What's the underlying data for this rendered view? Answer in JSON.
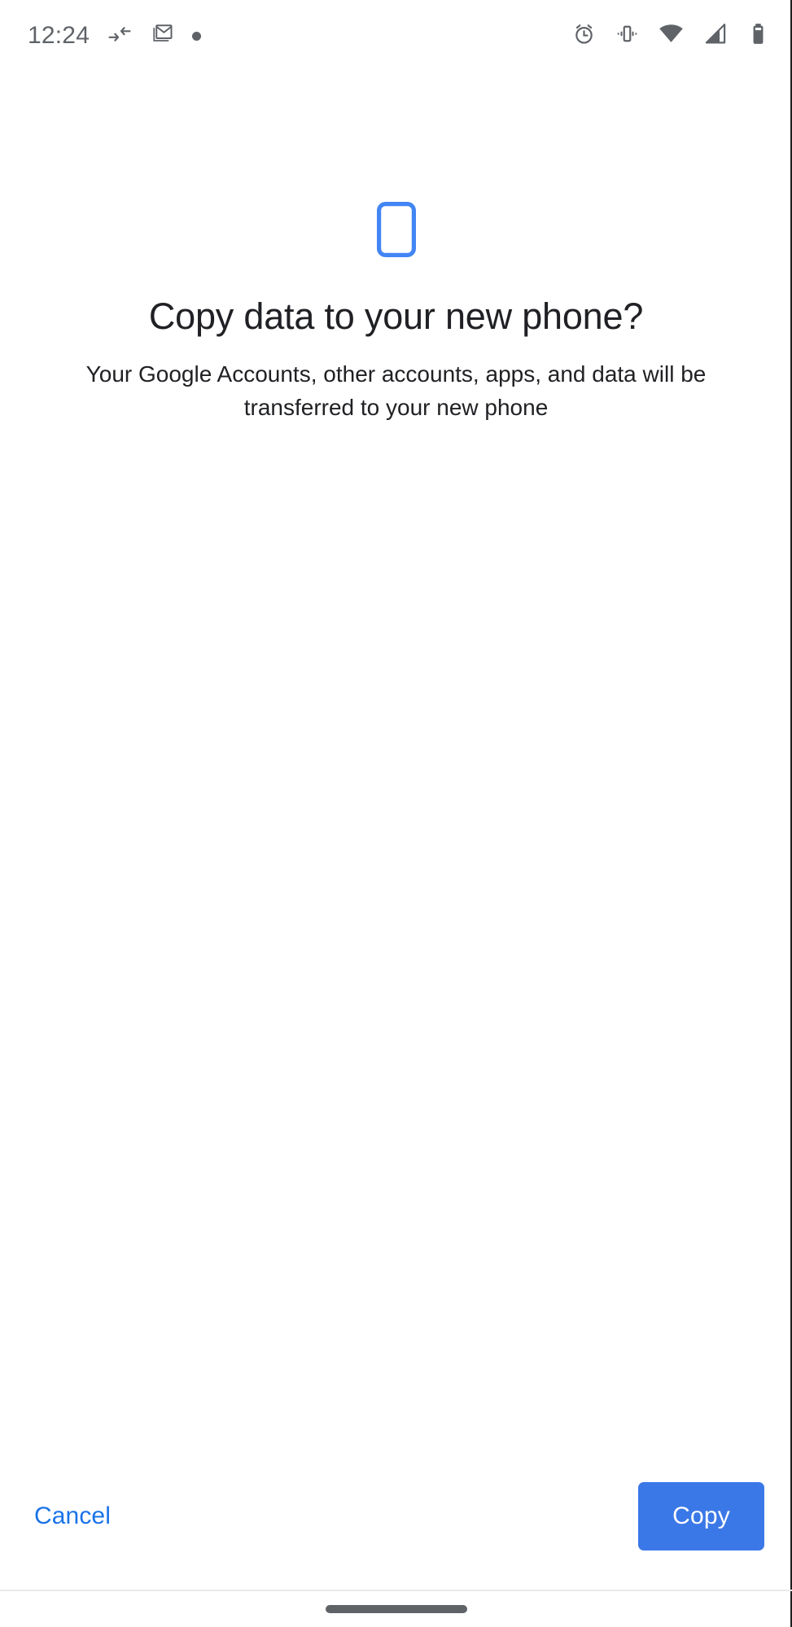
{
  "status_bar": {
    "clock": "12:24",
    "left_icons": [
      {
        "name": "data-transfer-icon",
        "label": "data transfer"
      },
      {
        "name": "gmail-icon",
        "label": "Gmail"
      },
      {
        "name": "notification-dot-icon",
        "label": "notification"
      }
    ],
    "right_icons": [
      {
        "name": "alarm-clock-icon",
        "label": "alarm set"
      },
      {
        "name": "vibrate-icon",
        "label": "ringer vibrate"
      },
      {
        "name": "wifi-icon",
        "label": "wifi full signal"
      },
      {
        "name": "cellular-signal-icon",
        "label": "cellular signal 2 bars"
      },
      {
        "name": "battery-icon",
        "label": "battery full"
      }
    ],
    "icon_color": "#5f6368"
  },
  "hero": {
    "illustration": "smartphone-icon",
    "illustration_color": "#4285f4",
    "title": "Copy data to your new phone?",
    "subtitle": "Your Google Accounts, other accounts, apps, and data will be transferred to your new phone"
  },
  "actions": {
    "cancel_label": "Cancel",
    "cancel_color": "#1a73e8",
    "copy_label": "Copy",
    "copy_background": "#3b78e7",
    "copy_text_color": "#ffffff"
  },
  "navigation_bar": {
    "gesture_handle": "home-gesture-handle",
    "handle_color": "#5f6368",
    "divider_color": "#e8eaed"
  }
}
